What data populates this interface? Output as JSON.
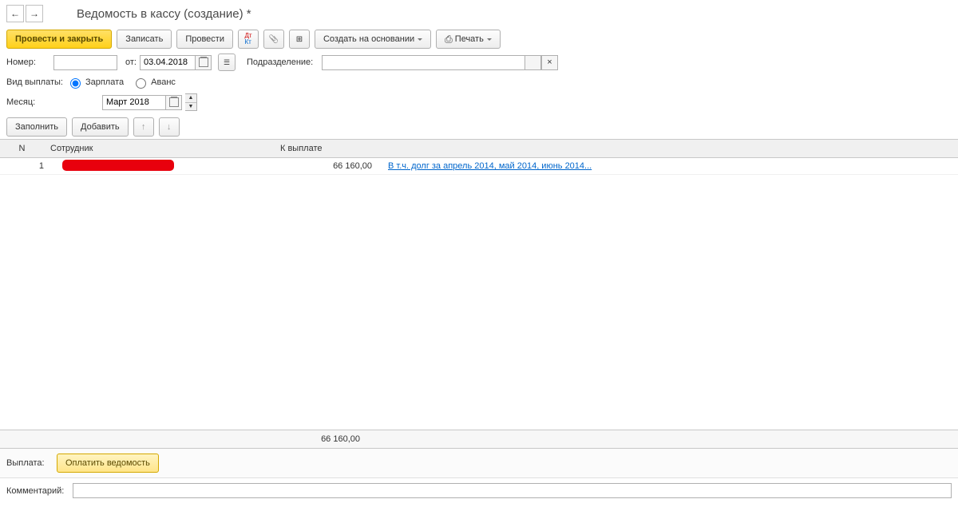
{
  "title": "Ведомость в кассу (создание) *",
  "toolbar": {
    "post_close": "Провести и закрыть",
    "save": "Записать",
    "post": "Провести",
    "create_based": "Создать на основании",
    "print": "Печать"
  },
  "form": {
    "number_label": "Номер:",
    "number_value": "",
    "from_label": "от:",
    "date_value": "03.04.2018",
    "department_label": "Подразделение:",
    "department_value": "",
    "pay_type_label": "Вид выплаты:",
    "pay_type_salary": "Зарплата",
    "pay_type_advance": "Аванс",
    "month_label": "Месяц:",
    "month_value": "Март 2018",
    "fill": "Заполнить",
    "add": "Добавить"
  },
  "table": {
    "col_n": "N",
    "col_employee": "Сотрудник",
    "col_topay": "К выплате",
    "rows": [
      {
        "n": "1",
        "amount": "66 160,00",
        "note": "В т.ч. долг за апрель 2014, май 2014, июнь 2014..."
      }
    ],
    "total_amount": "66 160,00"
  },
  "bottom": {
    "payout_label": "Выплата:",
    "pay_document": "Оплатить ведомость",
    "comment_label": "Комментарий:",
    "comment_value": ""
  }
}
